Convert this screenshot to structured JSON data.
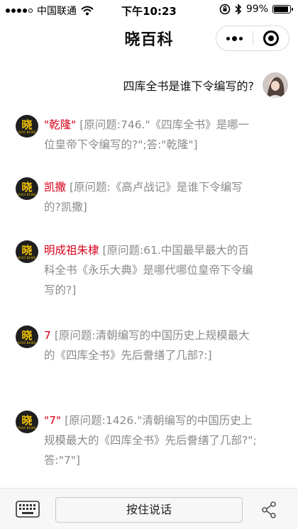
{
  "status_bar": {
    "carrier": "中国联通",
    "time": "下午10:23",
    "battery_text": "99%",
    "battery_level": 0.99,
    "signal_bars": 4,
    "signal_total": 5
  },
  "nav": {
    "title": "晓百科"
  },
  "user_message": {
    "text": "四库全书是谁下令编写的?"
  },
  "bot": {
    "avatar_char": "晓",
    "avatar_tag": "XIAO BAIKE"
  },
  "answers": [
    {
      "answer": "\"乾隆\"",
      "detail": "[原问题:746.\"《四库全书》是哪一位皇帝下令编写的?\";答:\"乾隆\"]"
    },
    {
      "answer": "凯撒",
      "detail": "[原问题:《高卢战记》是谁下令编写的?凯撒]"
    },
    {
      "answer": "明成祖朱棣",
      "detail": "[原问题:61.中国最早最大的百科全书《永乐大典》是哪代哪位皇帝下令编写的?]"
    },
    {
      "answer": "7",
      "detail": "[原问题:清朝编写的中国历史上规模最大的《四库全书》先后誊缮了几部?:]"
    },
    {
      "answer": "\"7\"",
      "detail": "[原问题:1426.\"清朝编写的中国历史上规模最大的《四库全书》先后誊缮了几部?\";答:\"7\"]"
    }
  ],
  "bottom_bar": {
    "hold_to_talk": "按住说话"
  },
  "colors": {
    "highlight": "#d9001b",
    "muted_text": "#8a8a8a",
    "avatar_bg": "#1f1f1f",
    "avatar_fg": "#f2c300"
  }
}
